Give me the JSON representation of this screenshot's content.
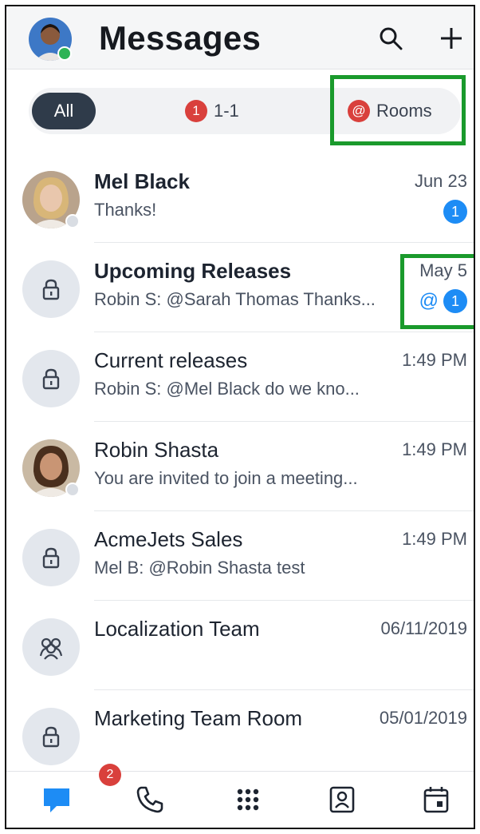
{
  "header": {
    "title": "Messages"
  },
  "filters": {
    "all_label": "All",
    "one_to_one": {
      "badge": "1",
      "label": "1-1"
    },
    "rooms": {
      "badge": "@",
      "label": "Rooms"
    }
  },
  "conversations": [
    {
      "name": "Mel Black",
      "preview": "Thanks!",
      "time": "Jun 23",
      "unread": "1",
      "mention": "",
      "bold": true,
      "avatar": "person"
    },
    {
      "name": "Upcoming Releases",
      "preview": "Robin S: @Sarah Thomas Thanks...",
      "time": "May 5",
      "unread": "1",
      "mention": "@",
      "bold": true,
      "avatar": "lock"
    },
    {
      "name": "Current releases",
      "preview": "Robin S: @Mel Black do we kno...",
      "time": "1:49 PM",
      "unread": "",
      "mention": "",
      "bold": false,
      "avatar": "lock"
    },
    {
      "name": "Robin Shasta",
      "preview": "You are invited to join a meeting...",
      "time": "1:49 PM",
      "unread": "",
      "mention": "",
      "bold": false,
      "avatar": "person"
    },
    {
      "name": "AcmeJets Sales",
      "preview": "Mel B: @Robin Shasta test",
      "time": "1:49 PM",
      "unread": "",
      "mention": "",
      "bold": false,
      "avatar": "lock"
    },
    {
      "name": "Localization Team",
      "preview": "",
      "time": "06/11/2019",
      "unread": "",
      "mention": "",
      "bold": false,
      "avatar": "team"
    },
    {
      "name": "Marketing Team Room",
      "preview": "",
      "time": "05/01/2019",
      "unread": "",
      "mention": "",
      "bold": false,
      "avatar": "lock"
    }
  ],
  "bottom_nav": {
    "items": [
      "messages-icon",
      "phone-icon",
      "dialpad-icon",
      "contacts-icon",
      "calendar-icon"
    ],
    "messages_badge": "2"
  },
  "colors": {
    "accent": "#1d8cf5",
    "alert": "#d9403c",
    "highlight": "#1a9a2c",
    "online": "#2eb356"
  }
}
